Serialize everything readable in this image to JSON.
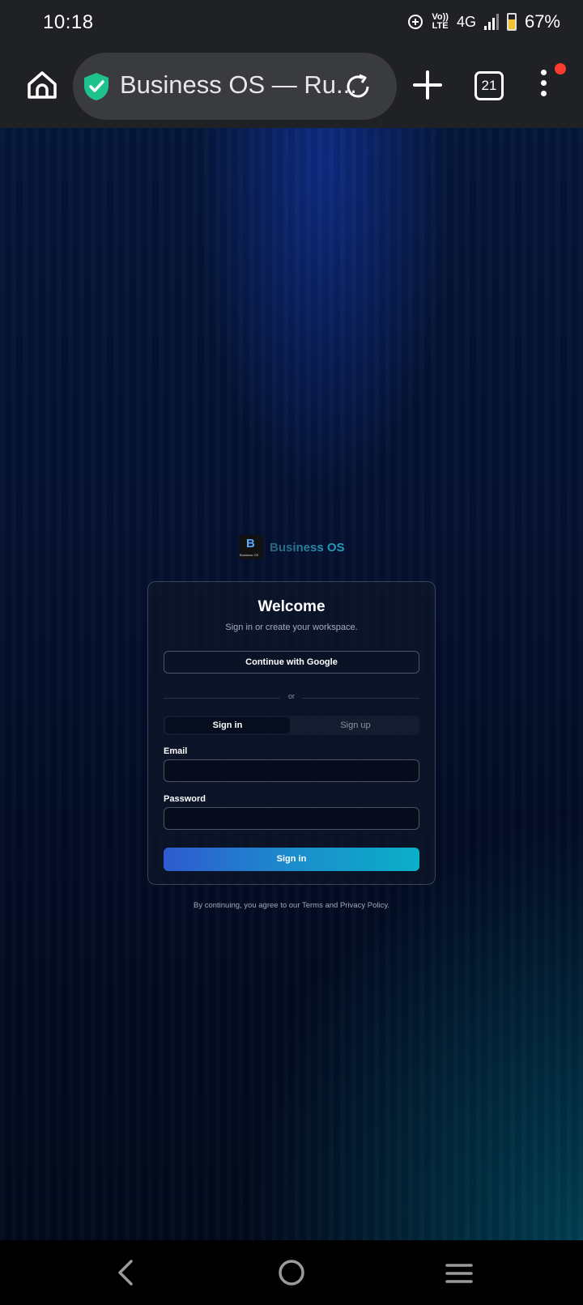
{
  "status_bar": {
    "time": "10:18",
    "volte_top": "Vo))",
    "volte_bottom": "LTE",
    "network": "4G",
    "battery_percent": "67%",
    "battery_level": 0.67
  },
  "browser": {
    "url_title": "Business OS — Ru...",
    "tab_count": "21",
    "colors": {
      "secure_shield": "#1ec28b",
      "notification_dot": "#ff3b30"
    }
  },
  "page": {
    "brand": {
      "logo_text": "Business OS",
      "name": "Business OS"
    },
    "card": {
      "title": "Welcome",
      "subtitle": "Sign in or create your workspace.",
      "google_button": "Continue with Google",
      "divider_text": "or",
      "tabs": [
        {
          "label": "Sign in",
          "active": true
        },
        {
          "label": "Sign up",
          "active": false
        }
      ],
      "email_label": "Email",
      "email_value": "",
      "password_label": "Password",
      "password_value": "",
      "submit_label": "Sign in"
    },
    "legal_text": "By continuing, you agree to our Terms and Privacy Policy."
  },
  "nav_bar": {
    "icons": [
      "back-icon",
      "home-circle-icon",
      "recents-icon"
    ]
  }
}
